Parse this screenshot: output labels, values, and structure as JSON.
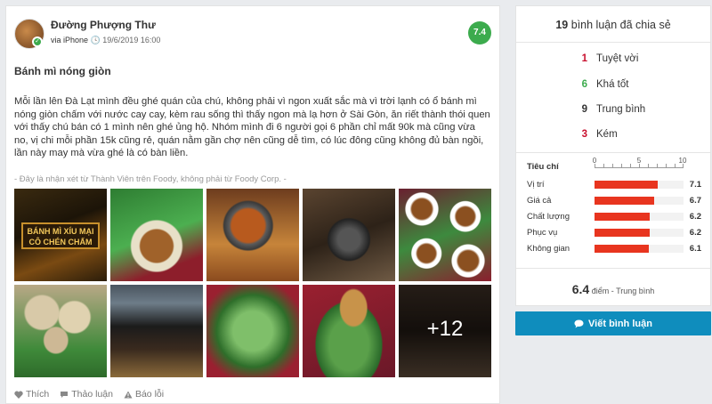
{
  "review": {
    "user_name": "Đường Phượng Thư",
    "via": "via iPhone",
    "date": "19/6/2019 16:00",
    "score": "7.4",
    "title": "Bánh mì nóng giòn",
    "body": "Mỗi lần lên Đà Lạt mình đều ghé quán của chú, không phải vì ngon xuất sắc mà vì trời lạnh có ổ bánh mì nóng giòn chấm với nước cay cay, kèm rau sống thì thấy ngon mà lạ hơn ở Sài Gòn, ăn riết thành thói quen với thấy chú bán có 1 mình nên ghé ủng hộ. Nhóm mình đi 6 người gọi 6 phần chỉ mất 90k mà cũng vừa no, vị chi mỗi phần 15k cũng rẻ, quán nằm gần chợ nên cũng dễ tìm, có lúc đông cũng không đủ bàn ngồi, lần này may mà vừa ghé là có bàn liền.",
    "note": "- Đây là nhận xét từ Thành Viên trên Foody, không phải từ Foody Corp. -",
    "sign_line1": "BÁNH MÌ XÍU MẠI",
    "sign_line2": "CÔ CHÉN CHẤM",
    "more_photos": "+12",
    "actions": {
      "like": "Thích",
      "discuss": "Thảo luận",
      "report": "Báo lỗi"
    }
  },
  "summary": {
    "count": "19",
    "count_text": "bình luận đã chia sẻ",
    "counts": [
      {
        "num": "1",
        "label": "Tuyệt vời",
        "color": "#c8102e"
      },
      {
        "num": "6",
        "label": "Khá tốt",
        "color": "#3cab4d"
      },
      {
        "num": "9",
        "label": "Trung bình",
        "color": "#333333"
      },
      {
        "num": "3",
        "label": "Kém",
        "color": "#c8102e"
      }
    ],
    "criteria_header": "Tiêu chí",
    "scale_labels": [
      "0",
      "5",
      "10"
    ],
    "criteria": [
      {
        "name": "Vị trí",
        "value": 7.1,
        "value_text": "7.1"
      },
      {
        "name": "Giá cả",
        "value": 6.7,
        "value_text": "6.7"
      },
      {
        "name": "Chất lượng",
        "value": 6.2,
        "value_text": "6.2"
      },
      {
        "name": "Phục vụ",
        "value": 6.2,
        "value_text": "6.2"
      },
      {
        "name": "Không gian",
        "value": 6.1,
        "value_text": "6.1"
      }
    ],
    "avg_score": "6.4",
    "avg_unit": "điểm",
    "avg_label": "- Trung bình",
    "write_button": "Viết bình luận"
  },
  "colors": {
    "score_green": "#3cab4d",
    "bar_red": "#e8351f",
    "button_blue": "#0f8dbd"
  }
}
